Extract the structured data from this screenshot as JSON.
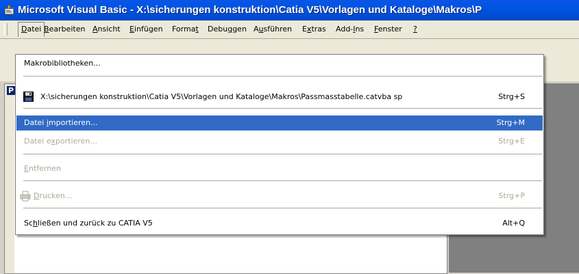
{
  "title": "Microsoft Visual Basic - X:\\sicherungen konstruktion\\Catia V5\\Vorlagen und Kataloge\\Makros\\P",
  "menubar": [
    {
      "label": "Datei",
      "key": "D"
    },
    {
      "label": "Bearbeiten",
      "key": "B"
    },
    {
      "label": "Ansicht",
      "key": "A"
    },
    {
      "label": "Einfügen",
      "key": "E"
    },
    {
      "label": "Format",
      "key": "t"
    },
    {
      "label": "Debuggen",
      "key": "g"
    },
    {
      "label": "Ausführen",
      "key": "u"
    },
    {
      "label": "Extras",
      "key": "x"
    },
    {
      "label": "Add-Ins",
      "key": "I"
    },
    {
      "label": "Fenster",
      "key": "F"
    },
    {
      "label": "?",
      "key": "?"
    }
  ],
  "panel_label": "P",
  "menu": {
    "items": [
      {
        "label": "Makrobibliotheken...",
        "shortcut": ""
      },
      {
        "label": "X:\\sicherungen konstruktion\\Catia V5\\Vorlagen und Kataloge\\Makros\\Passmasstabelle.catvba sp",
        "shortcut": "Strg+S"
      },
      {
        "label": "Datei importieren...",
        "shortcut": "Strg+M"
      },
      {
        "label": "Datei exportieren...",
        "shortcut": "Strg+E"
      },
      {
        "label": "Entfernen",
        "shortcut": ""
      },
      {
        "label": "Drucken...",
        "shortcut": "Strg+P"
      },
      {
        "label": "Schließen und zurück zu CATIA V5",
        "shortcut": "Alt+Q"
      }
    ]
  },
  "colors": {
    "titlebar": "#0054e3",
    "highlight": "#316ac5",
    "disabled": "#aca899",
    "workspace": "#808080"
  }
}
